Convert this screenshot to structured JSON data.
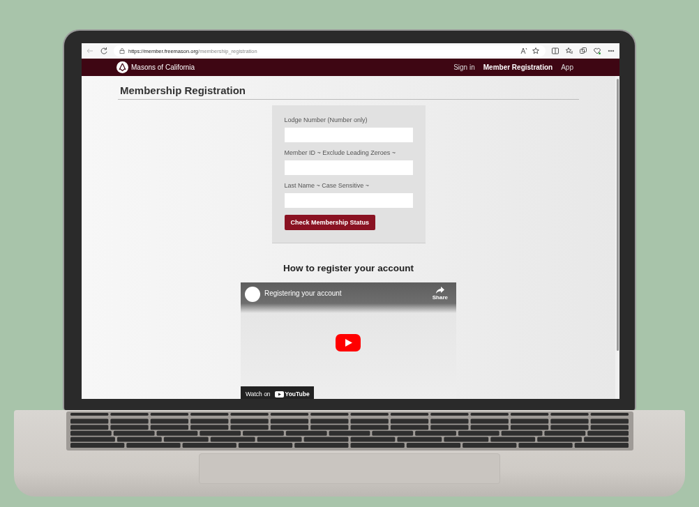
{
  "browser": {
    "url_host": "https://member.freemason.org",
    "url_path": "/membership_registration"
  },
  "nav": {
    "brand": "Masons of California",
    "links": [
      {
        "label": "Sign in",
        "selected": false
      },
      {
        "label": "Member Registration",
        "selected": true
      },
      {
        "label": "App",
        "selected": false
      }
    ]
  },
  "page": {
    "title": "Membership Registration"
  },
  "form": {
    "fields": [
      {
        "label": "Lodge Number (Number only)"
      },
      {
        "label": "Member ID ~ Exclude Leading Zeroes ~"
      },
      {
        "label": "Last Name ~ Case Sensitive ~"
      }
    ],
    "button": "Check Membership Status"
  },
  "video_section": {
    "heading": "How to register your account",
    "video": {
      "title": "Registering your account",
      "share": "Share",
      "watch_label": "Watch on",
      "brand": "YouTube"
    }
  }
}
